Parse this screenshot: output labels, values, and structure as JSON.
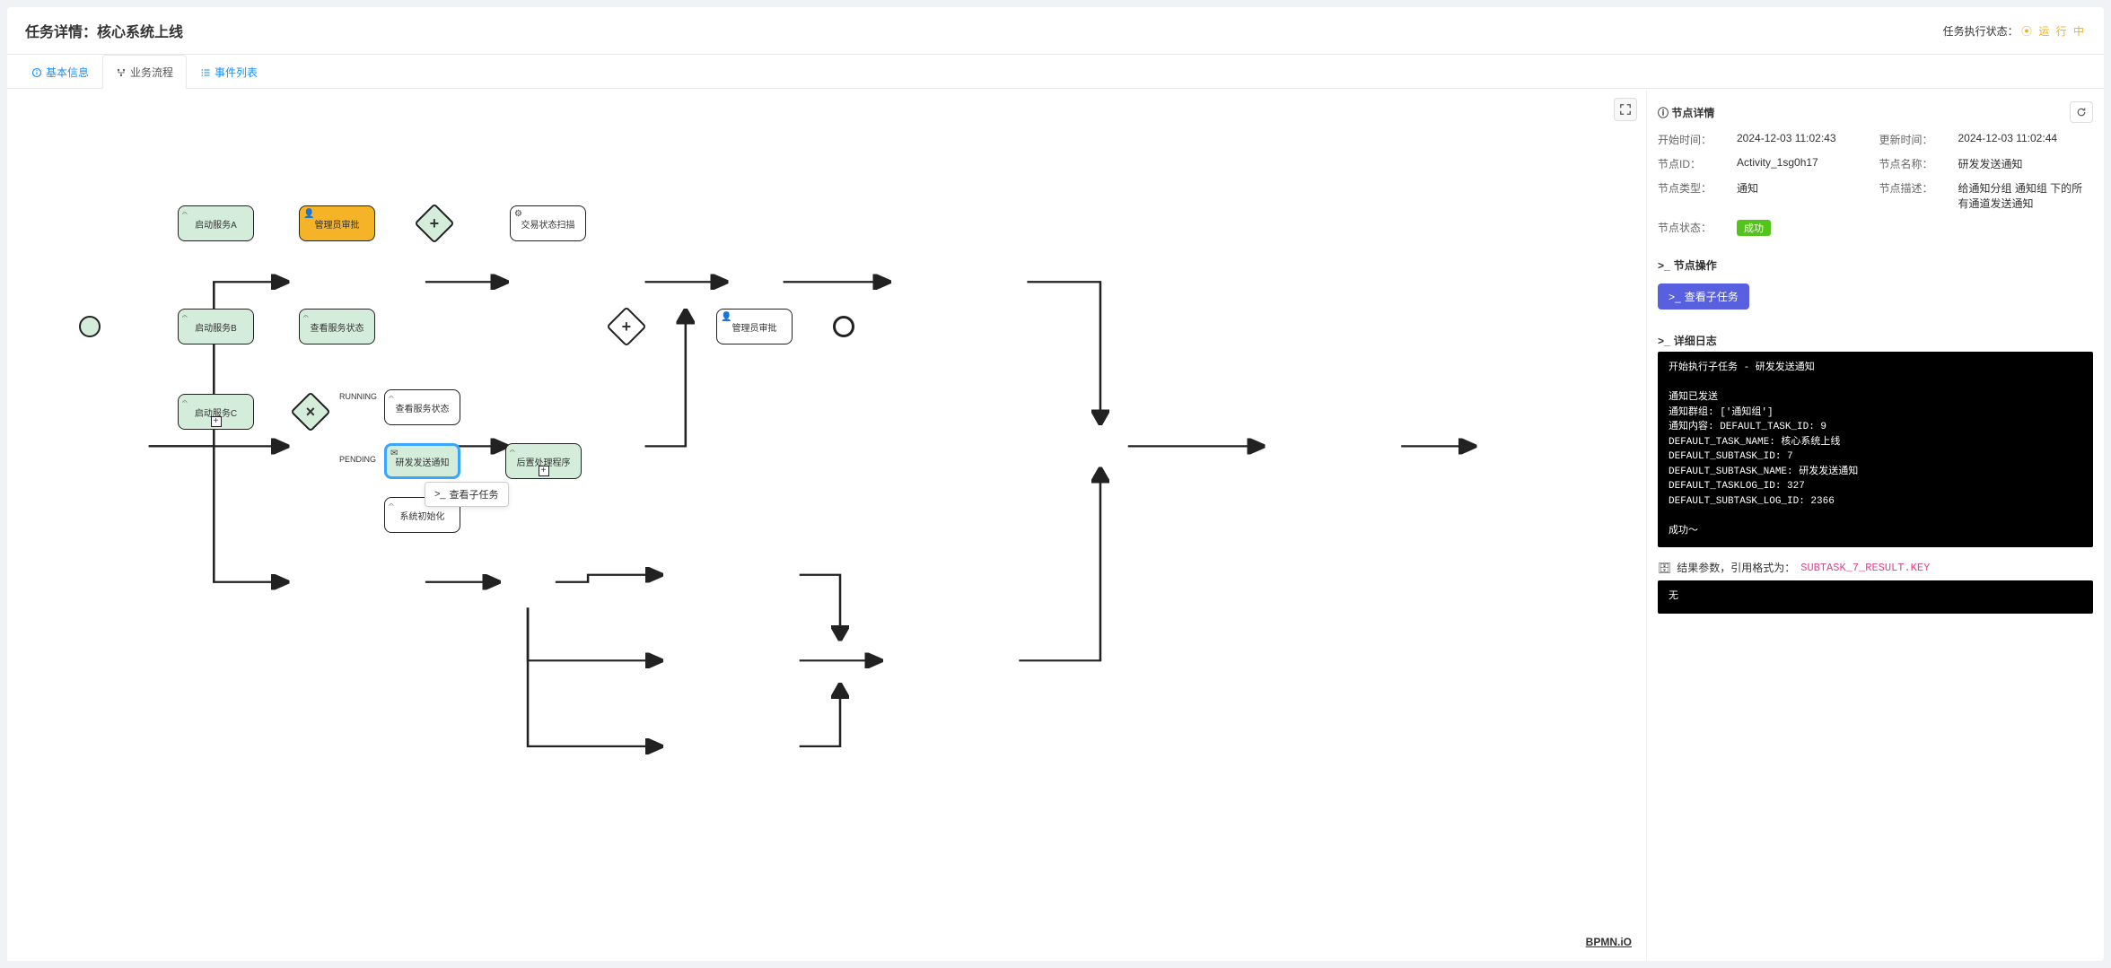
{
  "header": {
    "title": "任务详情：核心系统上线",
    "status_label": "任务执行状态：",
    "status_value": "运 行 中"
  },
  "tabs": {
    "basic": "基本信息",
    "flow": "业务流程",
    "events": "事件列表"
  },
  "diagram": {
    "start": "",
    "nodeA": "启动服务A",
    "nodeB": "启动服务B",
    "nodeC": "启动服务C",
    "approve1": "管理员审批",
    "checkStatus": "查看服务状态",
    "scan": "交易状态扫描",
    "checkStatus2": "查看服务状态",
    "notify": "研发发送通知",
    "sysInit": "系统初始化",
    "postProc": "后置处理程序",
    "approve2": "管理员审批",
    "labelRunning": "RUNNING",
    "labelPending": "PENDING",
    "tooltip": "查看子任务",
    "logo": "BPMN.iO"
  },
  "panel": {
    "title_detail": "节点详情",
    "labels": {
      "start_time": "开始时间：",
      "update_time": "更新时间：",
      "node_id": "节点ID：",
      "node_name": "节点名称：",
      "node_type": "节点类型：",
      "node_desc": "节点描述：",
      "node_status": "节点状态："
    },
    "values": {
      "start_time": "2024-12-03 11:02:43",
      "update_time": "2024-12-03 11:02:44",
      "node_id": "Activity_1sg0h17",
      "node_name": "研发发送通知",
      "node_type": "通知",
      "node_desc": "给通知分组 通知组 下的所有通道发送通知",
      "node_status": "成功"
    },
    "ops_title": "节点操作",
    "ops_button": "查看子任务",
    "log_title": "详细日志",
    "log_text": "开始执行子任务 - 研发发送通知\n\n通知已发送\n通知群组: ['通知组']\n通知内容: DEFAULT_TASK_ID: 9\nDEFAULT_TASK_NAME: 核心系统上线\nDEFAULT_SUBTASK_ID: 7\nDEFAULT_SUBTASK_NAME: 研发发送通知\nDEFAULT_TASKLOG_ID: 327\nDEFAULT_SUBTASK_LOG_ID: 2366\n\n成功～",
    "result_title": "结果参数，引用格式为：",
    "result_key": "SUBTASK_7_RESULT.KEY",
    "result_body": "无"
  }
}
